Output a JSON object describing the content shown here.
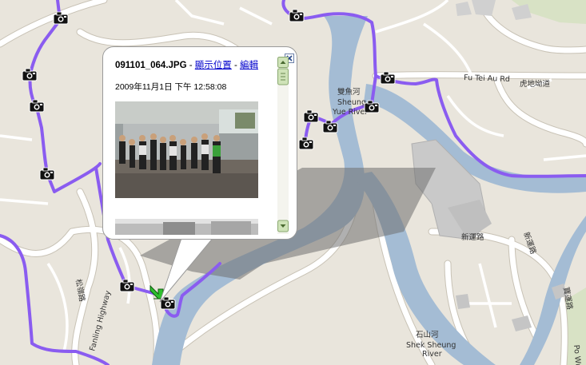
{
  "popup": {
    "filename": "091101_064.JPG",
    "sep1": " - ",
    "show_location": "顯示位置",
    "sep2": " - ",
    "edit": "編輯",
    "datetime": "2009年11月1日 下午 12:58:08"
  },
  "map_labels": {
    "fu_tei_au_rd": "Fu Tei Au Rd",
    "tiger_pit": "虎地坳道",
    "sheung_yue_cn": "雙魚河",
    "sheung_yue_en1": "Sheung",
    "sheung_yue_en2": "Yue River",
    "san_wan_rd": "新運路",
    "shek_sheung_cn": "石山河",
    "shek_sheung_en1": "Shek Sheung",
    "shek_sheung_en2": "River",
    "road_1": "松嶺路",
    "road_2": "Fanling Highway",
    "road_3": "Po Wu",
    "road_4": "新運路",
    "road_5": "寶運路"
  },
  "colors": {
    "route": "#8a5cf0",
    "river": "#99b3cc",
    "road": "#ffffff",
    "background": "#e9e5dc"
  },
  "icons": {
    "photo_marker": "camera-icon",
    "selected_marker": "green-arrow-icon",
    "close": "close-icon"
  }
}
